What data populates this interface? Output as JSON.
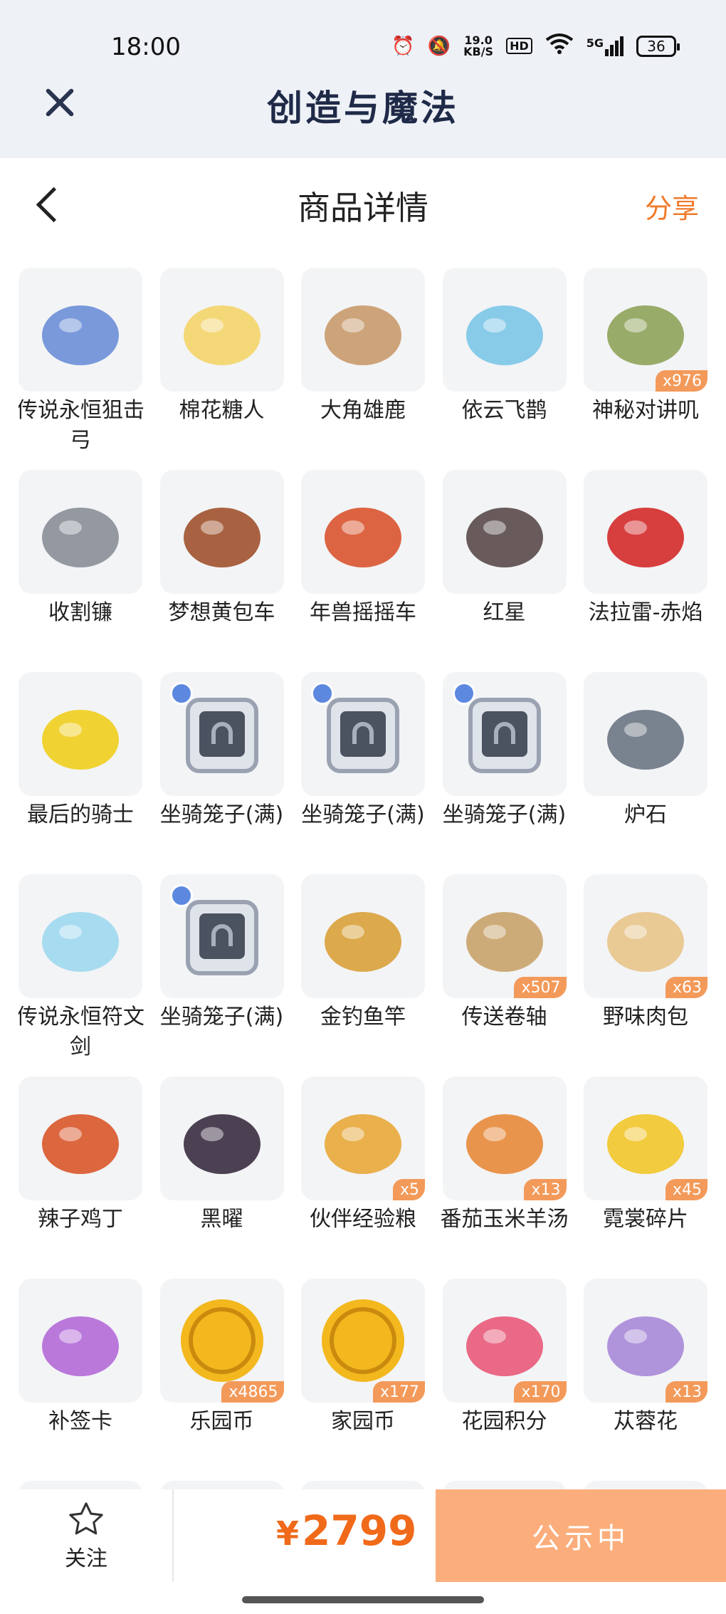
{
  "status_bar": {
    "time": "18:00",
    "net_speed_top": "19.0",
    "net_speed_unit": "KB/S",
    "hd": "HD",
    "signal": "5G",
    "battery": "36"
  },
  "app": {
    "title": "创造与魔法"
  },
  "header": {
    "title": "商品详情",
    "share": "分享"
  },
  "items": [
    {
      "name": "传说永恒狙击弓",
      "qty": "",
      "icon": "bow",
      "color": "#6b8fd8"
    },
    {
      "name": "棉花糖人",
      "qty": "",
      "icon": "marshmallow-creature",
      "color": "#f4d56a"
    },
    {
      "name": "大角雄鹿",
      "qty": "",
      "icon": "deer",
      "color": "#c99a6b"
    },
    {
      "name": "依云飞鹊",
      "qty": "",
      "icon": "drone",
      "color": "#7cc6e8"
    },
    {
      "name": "神秘对讲叽",
      "qty": "x976",
      "icon": "walkie-bird",
      "color": "#8fa35a"
    },
    {
      "name": "收割镰",
      "qty": "",
      "icon": "sickle",
      "color": "#8a8f98"
    },
    {
      "name": "梦想黄包车",
      "qty": "",
      "icon": "rickshaw",
      "color": "#a0522d"
    },
    {
      "name": "年兽摇摇车",
      "qty": "",
      "icon": "beast-cart",
      "color": "#d9542f"
    },
    {
      "name": "红星",
      "qty": "",
      "icon": "motorcycle",
      "color": "#5a4a4a"
    },
    {
      "name": "法拉雷-赤焰",
      "qty": "",
      "icon": "red-car",
      "color": "#d42a2a"
    },
    {
      "name": "最后的骑士",
      "qty": "",
      "icon": "yellow-car",
      "color": "#f0cf1e"
    },
    {
      "name": "坐骑笼子(满)",
      "qty": "",
      "icon": "mount-cage",
      "color": "#4b5260",
      "badge": true
    },
    {
      "name": "坐骑笼子(满)",
      "qty": "",
      "icon": "mount-cage",
      "color": "#4b5260",
      "badge": true
    },
    {
      "name": "坐骑笼子(满)",
      "qty": "",
      "icon": "mount-cage",
      "color": "#4b5260",
      "badge": true
    },
    {
      "name": "炉石",
      "qty": "",
      "icon": "hearthstone",
      "color": "#6b7584"
    },
    {
      "name": "传说永恒符文剑",
      "qty": "",
      "icon": "rune-sword",
      "color": "#9fd8f0"
    },
    {
      "name": "坐骑笼子(满)",
      "qty": "",
      "icon": "mount-cage",
      "color": "#4b5260",
      "badge": true
    },
    {
      "name": "金钓鱼竿",
      "qty": "",
      "icon": "fishing-rod",
      "color": "#d9a13a"
    },
    {
      "name": "传送卷轴",
      "qty": "x507",
      "icon": "scroll",
      "color": "#c9a36a"
    },
    {
      "name": "野味肉包",
      "qty": "x63",
      "icon": "buns",
      "color": "#e8c48a"
    },
    {
      "name": "辣子鸡丁",
      "qty": "",
      "icon": "chicken-dish",
      "color": "#d9572a"
    },
    {
      "name": "黑曜",
      "qty": "",
      "icon": "black-car",
      "color": "#3a2e40"
    },
    {
      "name": "伙伴经验粮",
      "qty": "x5",
      "icon": "food-bag",
      "color": "#e8a93a"
    },
    {
      "name": "番茄玉米羊汤",
      "qty": "x13",
      "icon": "soup",
      "color": "#e88a3a"
    },
    {
      "name": "霓裳碎片",
      "qty": "x45",
      "icon": "shirt",
      "color": "#f2c72a"
    },
    {
      "name": "补签卡",
      "qty": "",
      "icon": "ticket",
      "color": "#b46ad8"
    },
    {
      "name": "乐园币",
      "qty": "x4865",
      "icon": "coin",
      "color": "#f2b81e"
    },
    {
      "name": "家园币",
      "qty": "x177",
      "icon": "coin",
      "color": "#f2b81e"
    },
    {
      "name": "花园积分",
      "qty": "x170",
      "icon": "flower-badge",
      "color": "#e85a7a"
    },
    {
      "name": "苁蓉花",
      "qty": "x13",
      "icon": "flower-spike",
      "color": "#a98ad8"
    },
    {
      "name": "",
      "qty": "",
      "icon": "blue-plant",
      "color": "#5aa8d8"
    },
    {
      "name": "",
      "qty": "",
      "icon": "ornament",
      "color": "#e8c07a"
    },
    {
      "name": "",
      "qty": "",
      "icon": "wanted-poster",
      "color": "#c9a36a"
    },
    {
      "name": "",
      "qty": "",
      "icon": "wanted-poster",
      "color": "#c9a36a"
    },
    {
      "name": "",
      "qty": "",
      "icon": "wanted-poster",
      "color": "#c9a36a"
    }
  ],
  "bottom_bar": {
    "follow_label": "关注",
    "currency": "¥",
    "price": "2799",
    "status_button": "公示中"
  }
}
